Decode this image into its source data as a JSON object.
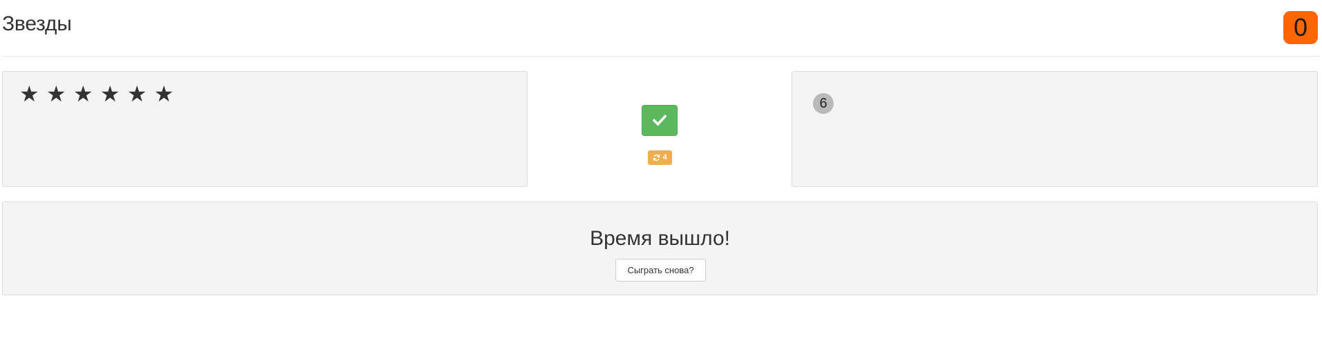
{
  "header": {
    "title": "Звезды",
    "score": "0"
  },
  "colors": {
    "score_badge": "#ff6600",
    "check_button": "#5cb85c",
    "refresh_badge": "#f0ad4e",
    "panel_background": "#f4f4f4",
    "number_circle": "#b9b9b9"
  },
  "left_panel": {
    "stars": [
      "★",
      "★",
      "★",
      "★",
      "★",
      "★"
    ],
    "star_count": 6
  },
  "controls": {
    "check_icon": "check-icon",
    "refresh_icon": "refresh-icon",
    "refresh_count": "4"
  },
  "right_panel": {
    "answer": "6"
  },
  "result": {
    "message": "Время вышло!",
    "replay_label": "Сыграть снова?"
  }
}
